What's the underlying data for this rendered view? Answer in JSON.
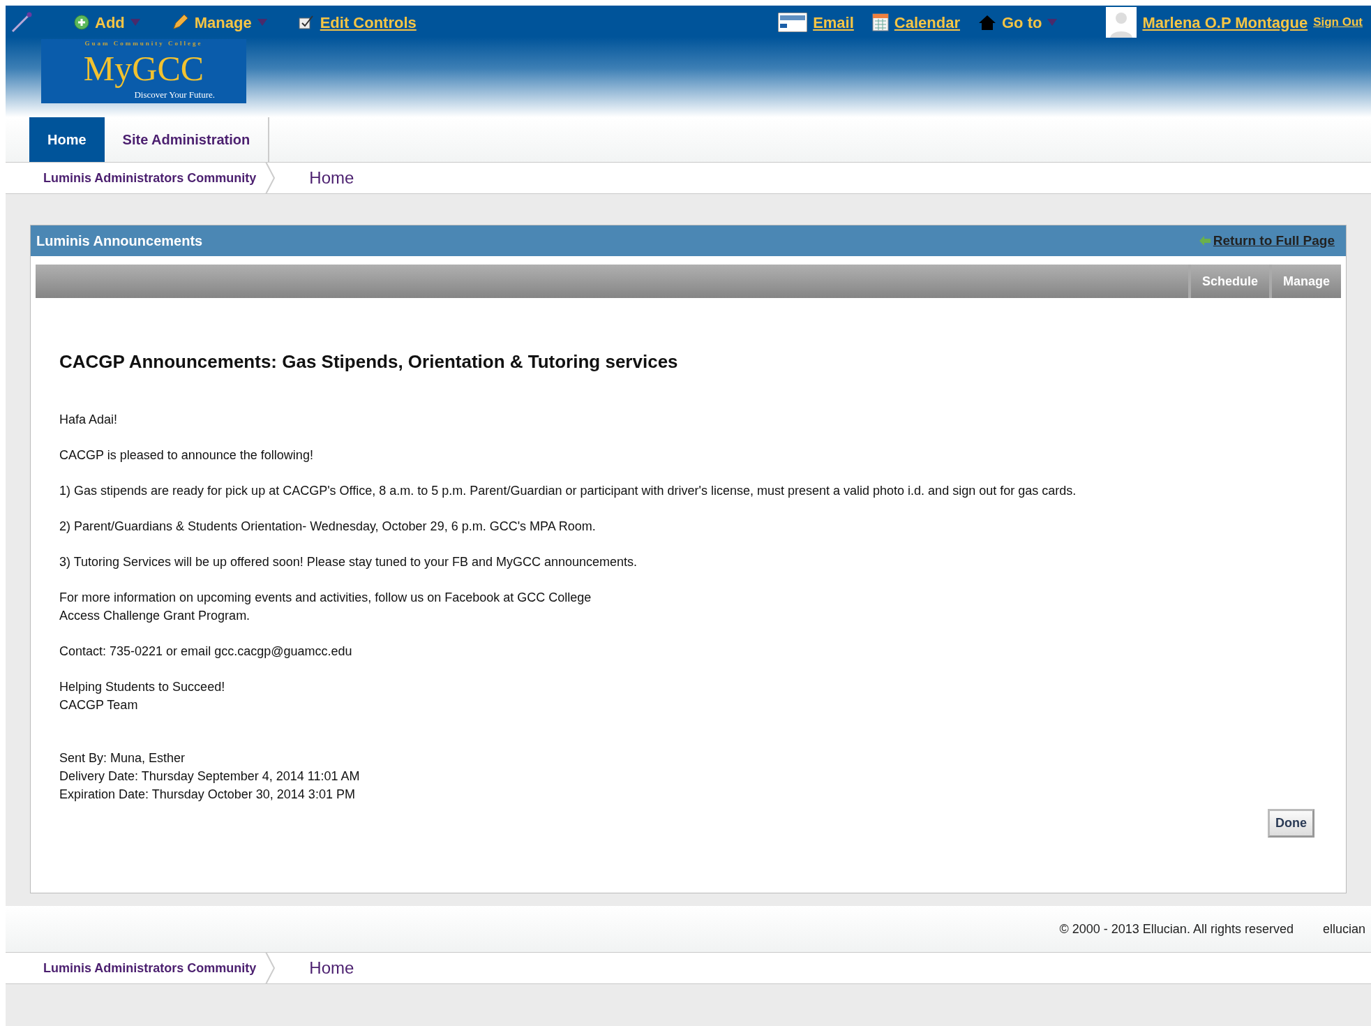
{
  "toolbar": {
    "left": [
      {
        "kind": "add",
        "label": "Add",
        "dropdown": true,
        "underlined": false
      },
      {
        "kind": "manage",
        "label": "Manage",
        "dropdown": true,
        "underlined": false
      },
      {
        "kind": "edit",
        "label": "Edit Controls",
        "dropdown": false,
        "underlined": true
      }
    ],
    "right": [
      {
        "kind": "email",
        "label": "Email",
        "dropdown": false,
        "underlined": true
      },
      {
        "kind": "calendar",
        "label": "Calendar",
        "dropdown": false,
        "underlined": true
      },
      {
        "kind": "home",
        "label": "Go to",
        "dropdown": true,
        "underlined": false
      }
    ],
    "user": {
      "name": "Marlena O.P Montague",
      "sign_out": "Sign Out"
    }
  },
  "logo": {
    "tagline_top": "Guam Community College",
    "title": "MyGCC",
    "tagline": "Discover Your Future."
  },
  "tabs": [
    {
      "label": "Home",
      "selected": true
    },
    {
      "label": "Site Administration",
      "selected": false
    }
  ],
  "breadcrumb": {
    "parent": "Luminis Administrators Community",
    "current": "Home"
  },
  "portlet": {
    "title": "Luminis Announcements",
    "return_link": "Return to Full Page",
    "actions": [
      "Schedule",
      "Manage"
    ],
    "heading": "CACGP Announcements: Gas Stipends, Orientation & Tutoring services",
    "paragraphs": [
      [
        "Hafa Adai!"
      ],
      [
        "CACGP is pleased to announce the following!"
      ],
      [
        "1) Gas stipends are ready for pick up at CACGP's Office, 8 a.m. to 5 p.m. Parent/Guardian or participant with driver's license, must present a valid photo i.d. and sign out for gas cards."
      ],
      [
        "2) Parent/Guardians & Students Orientation- Wednesday, October 29, 6 p.m. GCC's MPA Room."
      ],
      [
        "3) Tutoring Services will be up offered soon! Please stay tuned to your FB and MyGCC announcements."
      ],
      [
        "For more information on upcoming events and activities, follow us on Facebook at GCC College",
        "Access Challenge Grant Program."
      ],
      [
        "Contact: 735-0221 or email gcc.cacgp@guamcc.edu"
      ],
      [
        "Helping Students to Succeed!",
        "CACGP Team"
      ]
    ],
    "meta": [
      "Sent By: Muna, Esther",
      "Delivery Date: Thursday September 4, 2014 11:01 AM",
      "Expiration Date: Thursday October 30, 2014 3:01 PM"
    ],
    "done": "Done"
  },
  "footer": {
    "copyright": "© 2000 - 2013 Ellucian. All rights reserved",
    "brand": "ellucian"
  },
  "footer_breadcrumb": {
    "parent": "Luminis Administrators Community",
    "current": "Home"
  }
}
